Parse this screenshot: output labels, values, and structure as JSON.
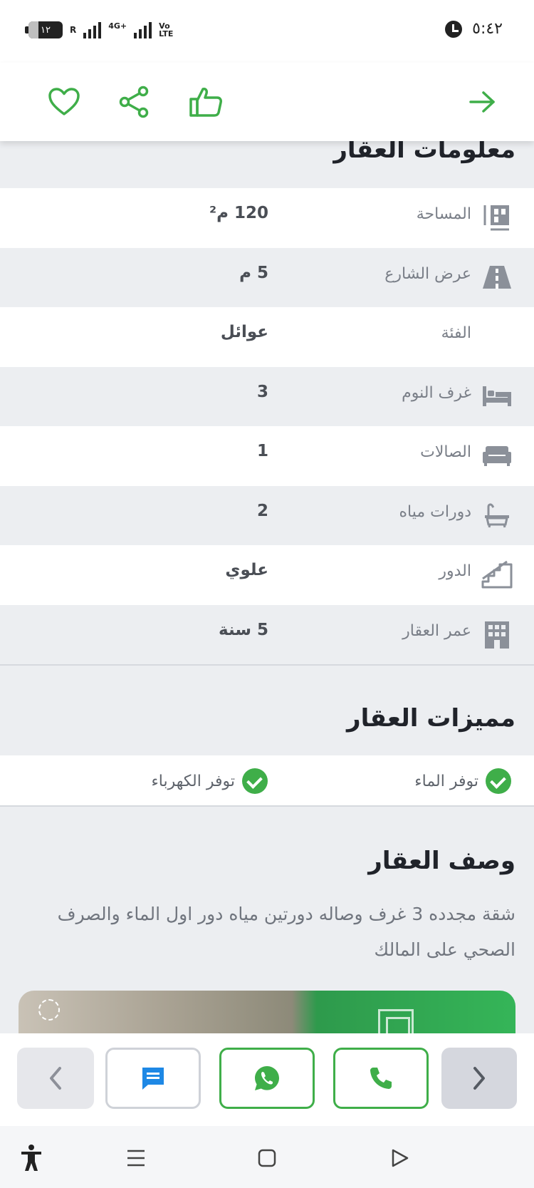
{
  "status_bar": {
    "battery": "١٢",
    "signal_labels": [
      "R",
      "4G+",
      "Vo LTE"
    ],
    "time": "٥:٤٢"
  },
  "toolbar": {
    "icons": [
      "heart-icon",
      "share-icon",
      "thumbs-up-icon",
      "arrow-right-icon"
    ],
    "accent_color": "#3fae49"
  },
  "property_info": {
    "title": "معلومات العقار",
    "rows": [
      {
        "label": "المساحة",
        "value": "120 م²",
        "icon": "area-icon"
      },
      {
        "label": "عرض الشارع",
        "value": "5 م",
        "icon": "road-icon"
      },
      {
        "label": "الفئة",
        "value": "عوائل",
        "icon": ""
      },
      {
        "label": "غرف النوم",
        "value": "3",
        "icon": "bed-icon"
      },
      {
        "label": "الصالات",
        "value": "1",
        "icon": "sofa-icon"
      },
      {
        "label": "دورات مياه",
        "value": "2",
        "icon": "bathtub-icon"
      },
      {
        "label": "الدور",
        "value": "علوي",
        "icon": "stairs-icon"
      },
      {
        "label": "عمر العقار",
        "value": "5 سنة",
        "icon": "building-icon"
      }
    ]
  },
  "features": {
    "title": "مميزات العقار",
    "items": [
      "توفر الماء",
      "توفر الكهرباء"
    ]
  },
  "description": {
    "title": "وصف العقار",
    "text": "شقة مجدده 3 غرف وصاله دورتين مياه دور اول الماء والصرف الصحي على المالك"
  },
  "actions": {
    "icons": [
      "chevron-left-icon",
      "chat-icon",
      "whatsapp-icon",
      "phone-icon",
      "chevron-right-icon"
    ]
  },
  "navigation": {
    "icons": [
      "accessibility-icon",
      "menu-icon",
      "home-icon",
      "back-icon"
    ]
  }
}
